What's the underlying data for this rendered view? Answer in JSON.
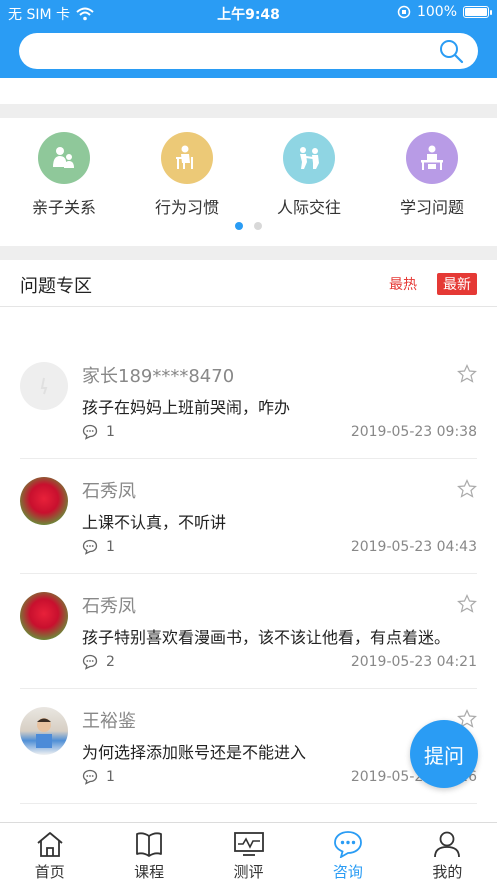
{
  "status_bar": {
    "carrier": "无 SIM 卡",
    "time": "上午9:48",
    "battery": "100%"
  },
  "search": {
    "placeholder": ""
  },
  "categories": [
    {
      "label": "亲子关系",
      "icon": "parent-child-icon",
      "color": "#8fc89a"
    },
    {
      "label": "行为习惯",
      "icon": "reading-child-icon",
      "color": "#ecc977"
    },
    {
      "label": "人际交往",
      "icon": "kids-playing-icon",
      "color": "#8fd5e3"
    },
    {
      "label": "学习问题",
      "icon": "student-desk-icon",
      "color": "#b89be6"
    }
  ],
  "pager": {
    "pages": 2,
    "active": 1
  },
  "section": {
    "title": "问题专区",
    "sort_hot": "最热",
    "sort_new": "最新"
  },
  "questions": [
    {
      "user": "家长189****8470",
      "text": "孩子在妈妈上班前哭闹，咋办",
      "comments": "1",
      "date": "2019-05-23 09:38",
      "avatar": "default-avatar"
    },
    {
      "user": "石秀凤",
      "text": "上课不认真，不听讲",
      "comments": "1",
      "date": "2019-05-23 04:43",
      "avatar": "flower-avatar"
    },
    {
      "user": "石秀凤",
      "text": "孩子特别喜欢看漫画书，该不该让他看，有点着迷。",
      "comments": "2",
      "date": "2019-05-23 04:21",
      "avatar": "flower-avatar"
    },
    {
      "user": "王裕鉴",
      "text": "为何选择添加账号还是不能进入",
      "comments": "1",
      "date": "2019-05-23 20:26",
      "avatar": "child-photo-avatar"
    }
  ],
  "ask_button": "提问",
  "tabs": [
    {
      "label": "首页",
      "icon": "home-icon",
      "active": false
    },
    {
      "label": "课程",
      "icon": "book-icon",
      "active": false
    },
    {
      "label": "测评",
      "icon": "monitor-chart-icon",
      "active": false
    },
    {
      "label": "咨询",
      "icon": "chat-bubble-icon",
      "active": true
    },
    {
      "label": "我的",
      "icon": "user-icon",
      "active": false
    }
  ],
  "colors": {
    "primary": "#2a9cf4",
    "hot": "#e53935"
  }
}
